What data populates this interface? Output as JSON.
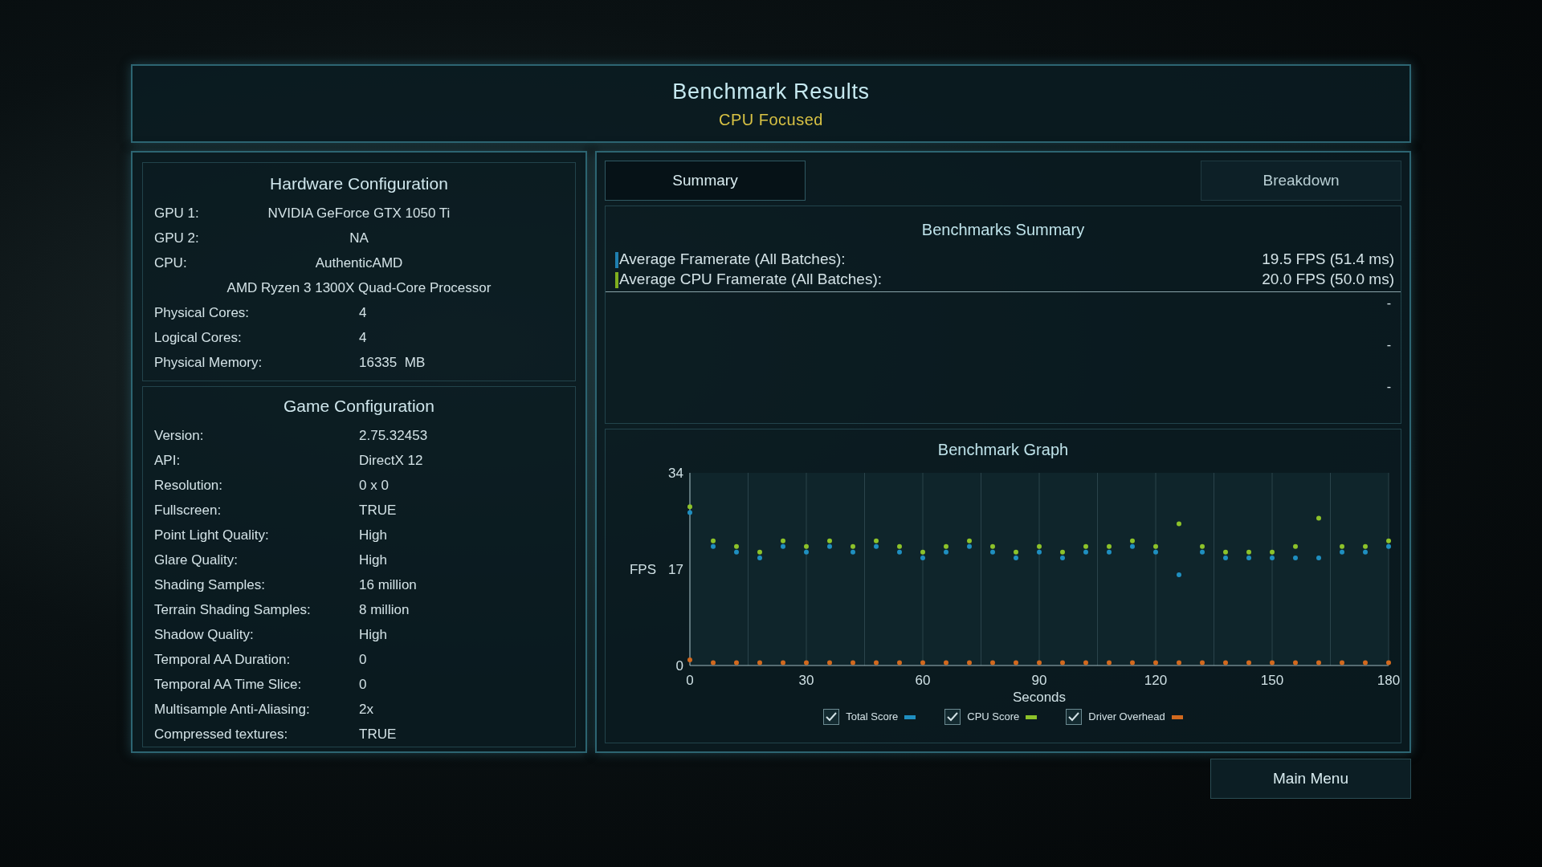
{
  "header": {
    "title": "Benchmark Results",
    "subtitle": "CPU Focused"
  },
  "hardware": {
    "title": "Hardware Configuration",
    "rows": [
      {
        "kind": "centered",
        "label": "GPU 1:",
        "value": "NVIDIA GeForce GTX 1050 Ti"
      },
      {
        "kind": "centered",
        "label": "GPU 2:",
        "value": "NA"
      },
      {
        "kind": "centered",
        "label": "CPU:",
        "value": "AuthenticAMD"
      },
      {
        "kind": "line",
        "value": "AMD Ryzen 3 1300X Quad-Core Processor"
      },
      {
        "kind": "pair",
        "label": "Physical Cores:",
        "value": "4"
      },
      {
        "kind": "pair",
        "label": "Logical Cores:",
        "value": "4"
      },
      {
        "kind": "pair",
        "label": "Physical Memory:",
        "value": "16335  MB"
      }
    ]
  },
  "game": {
    "title": "Game Configuration",
    "rows": [
      {
        "label": "Version:",
        "value": "2.75.32453"
      },
      {
        "label": "API:",
        "value": "DirectX 12"
      },
      {
        "label": "Resolution:",
        "value": "0 x 0"
      },
      {
        "label": "Fullscreen:",
        "value": "TRUE"
      },
      {
        "label": "Point Light Quality:",
        "value": "High"
      },
      {
        "label": "Glare Quality:",
        "value": "High"
      },
      {
        "label": "Shading Samples:",
        "value": "16 million"
      },
      {
        "label": "Terrain Shading Samples:",
        "value": "8 million"
      },
      {
        "label": "Shadow Quality:",
        "value": "High"
      },
      {
        "label": "Temporal AA Duration:",
        "value": "0"
      },
      {
        "label": "Temporal AA Time Slice:",
        "value": "0"
      },
      {
        "label": "Multisample Anti-Aliasing:",
        "value": "2x"
      },
      {
        "label": "Compressed textures:",
        "value": "TRUE"
      }
    ]
  },
  "tabs": [
    {
      "label": "Summary",
      "selected": true
    },
    {
      "label": "Breakdown",
      "selected": false
    }
  ],
  "summary": {
    "title": "Benchmarks Summary",
    "rows": [
      {
        "label": "Average Framerate (All Batches):",
        "value": "19.5 FPS (51.4 ms)",
        "color": "#1f7fb0"
      },
      {
        "label": "Average CPU Framerate (All Batches):",
        "value": "20.0 FPS (50.0 ms)",
        "color": "#7fae1e"
      }
    ],
    "placeholders": [
      "-",
      "-",
      "-"
    ]
  },
  "graph": {
    "title": "Benchmark Graph",
    "chart_data": {
      "type": "scatter",
      "xlabel": "Seconds",
      "ylabel": "FPS",
      "x": [
        0,
        6,
        12,
        18,
        24,
        30,
        36,
        42,
        48,
        54,
        60,
        66,
        72,
        78,
        84,
        90,
        96,
        102,
        108,
        114,
        120,
        126,
        132,
        138,
        144,
        150,
        156,
        162,
        168,
        174,
        180
      ],
      "series": [
        {
          "name": "Total Score",
          "color": "#1f8fc0",
          "values": [
            27,
            21,
            20,
            19,
            21,
            20,
            21,
            20,
            21,
            20,
            19,
            20,
            21,
            20,
            19,
            20,
            19,
            20,
            20,
            21,
            20,
            16,
            20,
            19,
            19,
            19,
            19,
            19,
            20,
            20,
            21
          ]
        },
        {
          "name": "CPU Score",
          "color": "#8dc22a",
          "values": [
            28,
            22,
            21,
            20,
            22,
            21,
            22,
            21,
            22,
            21,
            20,
            21,
            22,
            21,
            20,
            21,
            20,
            21,
            21,
            22,
            21,
            25,
            21,
            20,
            20,
            20,
            21,
            26,
            21,
            21,
            22
          ]
        },
        {
          "name": "Driver Overhead",
          "color": "#d2691e",
          "values": [
            1,
            0.5,
            0.5,
            0.5,
            0.5,
            0.5,
            0.5,
            0.5,
            0.5,
            0.5,
            0.5,
            0.5,
            0.5,
            0.5,
            0.5,
            0.5,
            0.5,
            0.5,
            0.5,
            0.5,
            0.5,
            0.5,
            0.5,
            0.5,
            0.5,
            0.5,
            0.5,
            0.5,
            0.5,
            0.5,
            0.5
          ]
        }
      ],
      "xlim": [
        0,
        180
      ],
      "ylim": [
        0,
        34
      ],
      "xticks": [
        0,
        30,
        60,
        90,
        120,
        150,
        180
      ],
      "yticks": [
        0,
        17,
        34
      ],
      "grid": true
    },
    "legend": [
      {
        "checked": true
      },
      {
        "checked": true
      },
      {
        "checked": true
      }
    ]
  },
  "main_menu": "Main Menu"
}
